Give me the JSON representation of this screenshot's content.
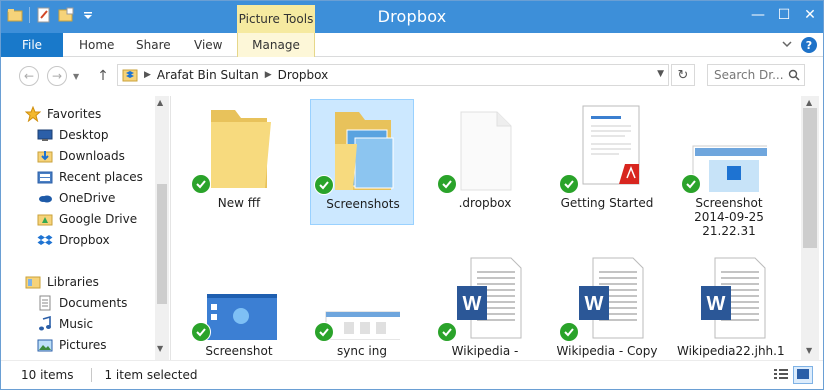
{
  "window": {
    "title": "Dropbox",
    "contextual_tab_group": "Picture Tools",
    "controls": {
      "minimize": "—",
      "maximize": "☐",
      "close": "✕"
    }
  },
  "ribbon": {
    "tabs": [
      {
        "label": "File"
      },
      {
        "label": "Home"
      },
      {
        "label": "Share"
      },
      {
        "label": "View"
      },
      {
        "label": "Manage"
      }
    ]
  },
  "address": {
    "crumbs": [
      "Arafat Bin Sultan",
      "Dropbox"
    ],
    "search_placeholder": "Search Dr..."
  },
  "nav": {
    "favorites_label": "Favorites",
    "favorites": [
      {
        "label": "Desktop",
        "icon": "desktop-icon"
      },
      {
        "label": "Downloads",
        "icon": "downloads-icon"
      },
      {
        "label": "Recent places",
        "icon": "recent-places-icon"
      },
      {
        "label": "OneDrive",
        "icon": "onedrive-icon"
      },
      {
        "label": "Google Drive",
        "icon": "google-drive-icon"
      },
      {
        "label": "Dropbox",
        "icon": "dropbox-icon"
      }
    ],
    "libraries_label": "Libraries",
    "libraries": [
      {
        "label": "Documents",
        "icon": "documents-icon"
      },
      {
        "label": "Music",
        "icon": "music-icon"
      },
      {
        "label": "Pictures",
        "icon": "pictures-icon"
      }
    ]
  },
  "files": [
    {
      "name": "New fff",
      "type": "folder",
      "selected": false
    },
    {
      "name": "Screenshots",
      "type": "folder-images",
      "selected": true
    },
    {
      "name": ".dropbox",
      "type": "blank-file",
      "selected": false
    },
    {
      "name": "Getting Started",
      "type": "pdf",
      "selected": false
    },
    {
      "name": "Screenshot\n2014-09-25\n21.22.31",
      "type": "image",
      "selected": false
    },
    {
      "name": "Screenshot",
      "type": "image",
      "selected": false
    },
    {
      "name": "sync ing",
      "type": "image",
      "selected": false
    },
    {
      "name": "Wikipedia -",
      "type": "word",
      "selected": false
    },
    {
      "name": "Wikipedia - Copy",
      "type": "word",
      "selected": false
    },
    {
      "name": "Wikipedia22.jhh.1",
      "type": "word",
      "selected": false
    }
  ],
  "status": {
    "item_count": "10 items",
    "selection": "1 item selected"
  },
  "colors": {
    "titlebar": "#3d8fd9",
    "file_tab": "#1979ca",
    "selection": "#cce8ff",
    "sync_check": "#2aa32a"
  }
}
